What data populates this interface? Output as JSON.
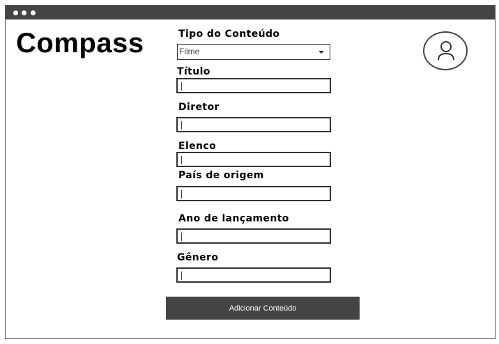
{
  "app": {
    "logo_text": "Compass"
  },
  "form": {
    "content_type": {
      "label": "Tipo do Conteúdo",
      "selected": "Filme"
    },
    "fields": [
      {
        "label": "Título",
        "value": ""
      },
      {
        "label": "Diretor",
        "value": ""
      },
      {
        "label": "Elenco",
        "value": ""
      },
      {
        "label": "País de origem",
        "value": ""
      },
      {
        "label": "Ano de lançamento",
        "value": ""
      },
      {
        "label": "Gênero",
        "value": ""
      }
    ],
    "submit_label": "Adicionar Conteúdo"
  },
  "user": {
    "avatar_icon": "user-icon"
  },
  "colors": {
    "titlebar": "#444444",
    "button": "#444444",
    "border": "#333333"
  }
}
